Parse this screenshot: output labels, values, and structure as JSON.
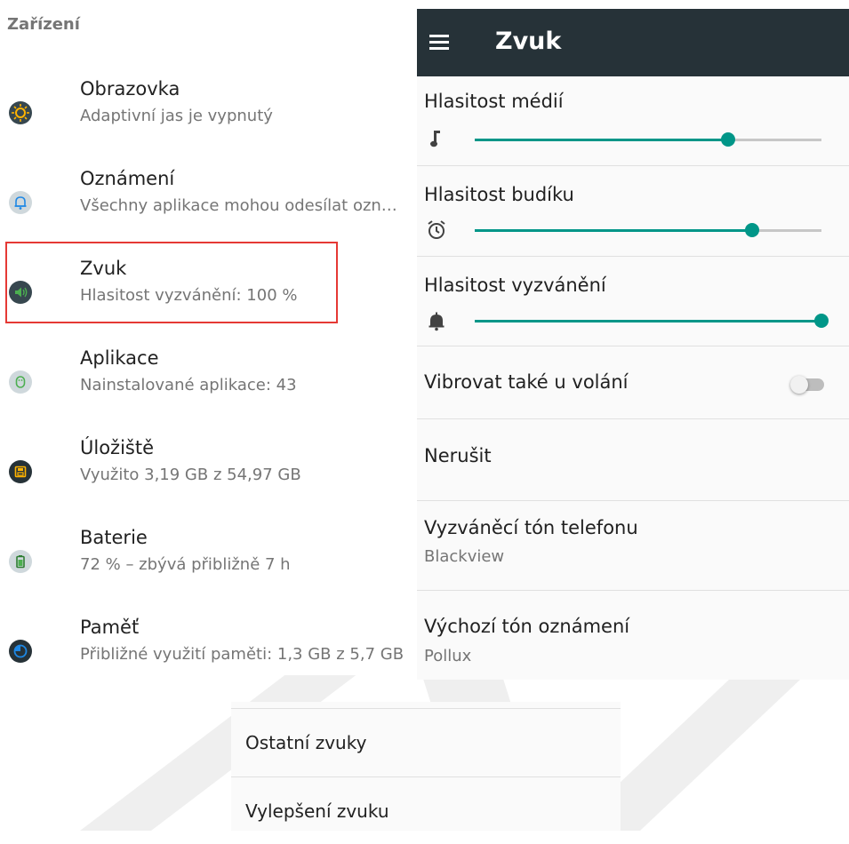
{
  "left_panel": {
    "section_title": "Zařízení",
    "items": [
      {
        "title": "Obrazovka",
        "subtitle": "Adaptivní jas je vypnutý",
        "icon": "display-brightness-icon"
      },
      {
        "title": "Oznámení",
        "subtitle": "Všechny aplikace mohou odesílat ozn…",
        "icon": "bell-icon"
      },
      {
        "title": "Zvuk",
        "subtitle": "Hlasitost vyzvánění: 100 %",
        "icon": "speaker-icon"
      },
      {
        "title": "Aplikace",
        "subtitle": "Nainstalované aplikace: 43",
        "icon": "android-icon"
      },
      {
        "title": "Úložiště",
        "subtitle": "Využito 3,19 GB z 54,97 GB",
        "icon": "storage-icon"
      },
      {
        "title": "Baterie",
        "subtitle": "72 % – zbývá přibližně 7 h",
        "icon": "battery-icon"
      },
      {
        "title": "Paměť",
        "subtitle": "Přibližné využití paměti: 1,3 GB z 5,7 GB",
        "icon": "memory-icon"
      }
    ]
  },
  "right_panel": {
    "appbar_title": "Zvuk",
    "volumes": [
      {
        "label": "Hlasitost médií",
        "icon": "music-note-icon",
        "level": 0.73
      },
      {
        "label": "Hlasitost budíku",
        "icon": "alarm-clock-icon",
        "level": 0.8
      },
      {
        "label": "Hlasitost vyzvánění",
        "icon": "bell-icon",
        "level": 1.0
      }
    ],
    "vibrate": {
      "label": "Vibrovat také u volání",
      "on": false
    },
    "do_not_disturb": {
      "label": "Nerušit"
    },
    "ringtone": {
      "label": "Vyzváněcí tón telefonu",
      "value": "Blackview"
    },
    "notification_tone": {
      "label": "Výchozí tón oznámení",
      "value": "Pollux"
    }
  },
  "bottom_panel": {
    "items": [
      {
        "label": "Ostatní zvuky"
      },
      {
        "label": "Vylepšení zvuku"
      }
    ]
  },
  "colors": {
    "accent": "#009688",
    "appbar": "#263238",
    "highlight": "#e53935"
  }
}
